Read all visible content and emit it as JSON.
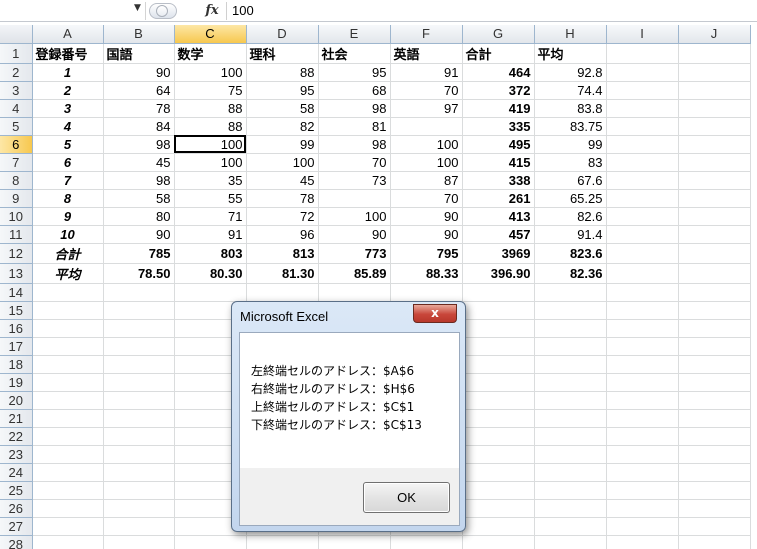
{
  "formula_bar": {
    "name_box_value": "",
    "fx_label": "fx",
    "formula_value": "100"
  },
  "sheet": {
    "columns": [
      "A",
      "B",
      "C",
      "D",
      "E",
      "F",
      "G",
      "H",
      "I",
      "J"
    ],
    "selected_column": "C",
    "selected_row": 6,
    "active_cell": "C6",
    "rows": [
      {
        "n": "1",
        "cells": [
          "登録番号",
          "国語",
          "数学",
          "理科",
          "社会",
          "英語",
          "合計",
          "平均",
          "",
          ""
        ]
      },
      {
        "n": "2",
        "cells": [
          "1",
          "90",
          "100",
          "88",
          "95",
          "91",
          "464",
          "92.8",
          "",
          ""
        ]
      },
      {
        "n": "3",
        "cells": [
          "2",
          "64",
          "75",
          "95",
          "68",
          "70",
          "372",
          "74.4",
          "",
          ""
        ]
      },
      {
        "n": "4",
        "cells": [
          "3",
          "78",
          "88",
          "58",
          "98",
          "97",
          "419",
          "83.8",
          "",
          ""
        ]
      },
      {
        "n": "5",
        "cells": [
          "4",
          "84",
          "88",
          "82",
          "81",
          "",
          "335",
          "83.75",
          "",
          ""
        ]
      },
      {
        "n": "6",
        "cells": [
          "5",
          "98",
          "100",
          "99",
          "98",
          "100",
          "495",
          "99",
          "",
          ""
        ]
      },
      {
        "n": "7",
        "cells": [
          "6",
          "45",
          "100",
          "100",
          "70",
          "100",
          "415",
          "83",
          "",
          ""
        ]
      },
      {
        "n": "8",
        "cells": [
          "7",
          "98",
          "35",
          "45",
          "73",
          "87",
          "338",
          "67.6",
          "",
          ""
        ]
      },
      {
        "n": "9",
        "cells": [
          "8",
          "58",
          "55",
          "78",
          "",
          "70",
          "261",
          "65.25",
          "",
          ""
        ]
      },
      {
        "n": "10",
        "cells": [
          "9",
          "80",
          "71",
          "72",
          "100",
          "90",
          "413",
          "82.6",
          "",
          ""
        ]
      },
      {
        "n": "11",
        "cells": [
          "10",
          "90",
          "91",
          "96",
          "90",
          "90",
          "457",
          "91.4",
          "",
          ""
        ]
      },
      {
        "n": "12",
        "cells": [
          "合計",
          "785",
          "803",
          "813",
          "773",
          "795",
          "3969",
          "823.6",
          "",
          ""
        ]
      },
      {
        "n": "13",
        "cells": [
          "平均",
          "78.50",
          "80.30",
          "81.30",
          "85.89",
          "88.33",
          "396.90",
          "82.36",
          "",
          ""
        ]
      },
      {
        "n": "14",
        "cells": [
          "",
          "",
          "",
          "",
          "",
          "",
          "",
          "",
          "",
          ""
        ]
      },
      {
        "n": "15",
        "cells": [
          "",
          "",
          "",
          "",
          "",
          "",
          "",
          "",
          "",
          ""
        ]
      },
      {
        "n": "16",
        "cells": [
          "",
          "",
          "",
          "",
          "",
          "",
          "",
          "",
          "",
          ""
        ]
      },
      {
        "n": "17",
        "cells": [
          "",
          "",
          "",
          "",
          "",
          "",
          "",
          "",
          "",
          ""
        ]
      },
      {
        "n": "18",
        "cells": [
          "",
          "",
          "",
          "",
          "",
          "",
          "",
          "",
          "",
          ""
        ]
      },
      {
        "n": "19",
        "cells": [
          "",
          "",
          "",
          "",
          "",
          "",
          "",
          "",
          "",
          ""
        ]
      },
      {
        "n": "20",
        "cells": [
          "",
          "",
          "",
          "",
          "",
          "",
          "",
          "",
          "",
          ""
        ]
      },
      {
        "n": "21",
        "cells": [
          "",
          "",
          "",
          "",
          "",
          "",
          "",
          "",
          "",
          ""
        ]
      },
      {
        "n": "22",
        "cells": [
          "",
          "",
          "",
          "",
          "",
          "",
          "",
          "",
          "",
          ""
        ]
      },
      {
        "n": "23",
        "cells": [
          "",
          "",
          "",
          "",
          "",
          "",
          "",
          "",
          "",
          ""
        ]
      },
      {
        "n": "24",
        "cells": [
          "",
          "",
          "",
          "",
          "",
          "",
          "",
          "",
          "",
          ""
        ]
      },
      {
        "n": "25",
        "cells": [
          "",
          "",
          "",
          "",
          "",
          "",
          "",
          "",
          "",
          ""
        ]
      },
      {
        "n": "26",
        "cells": [
          "",
          "",
          "",
          "",
          "",
          "",
          "",
          "",
          "",
          ""
        ]
      },
      {
        "n": "27",
        "cells": [
          "",
          "",
          "",
          "",
          "",
          "",
          "",
          "",
          "",
          ""
        ]
      },
      {
        "n": "28",
        "cells": [
          "",
          "",
          "",
          "",
          "",
          "",
          "",
          "",
          "",
          ""
        ]
      }
    ]
  },
  "dialog": {
    "title": "Microsoft Excel",
    "close_label": "x",
    "lines": [
      "左終端セルのアドレス：$A$6",
      "右終端セルのアドレス：$H$6",
      "上終端セルのアドレス：$C$1",
      "下終端セルのアドレス：$C$13"
    ],
    "ok_label": "OK"
  }
}
